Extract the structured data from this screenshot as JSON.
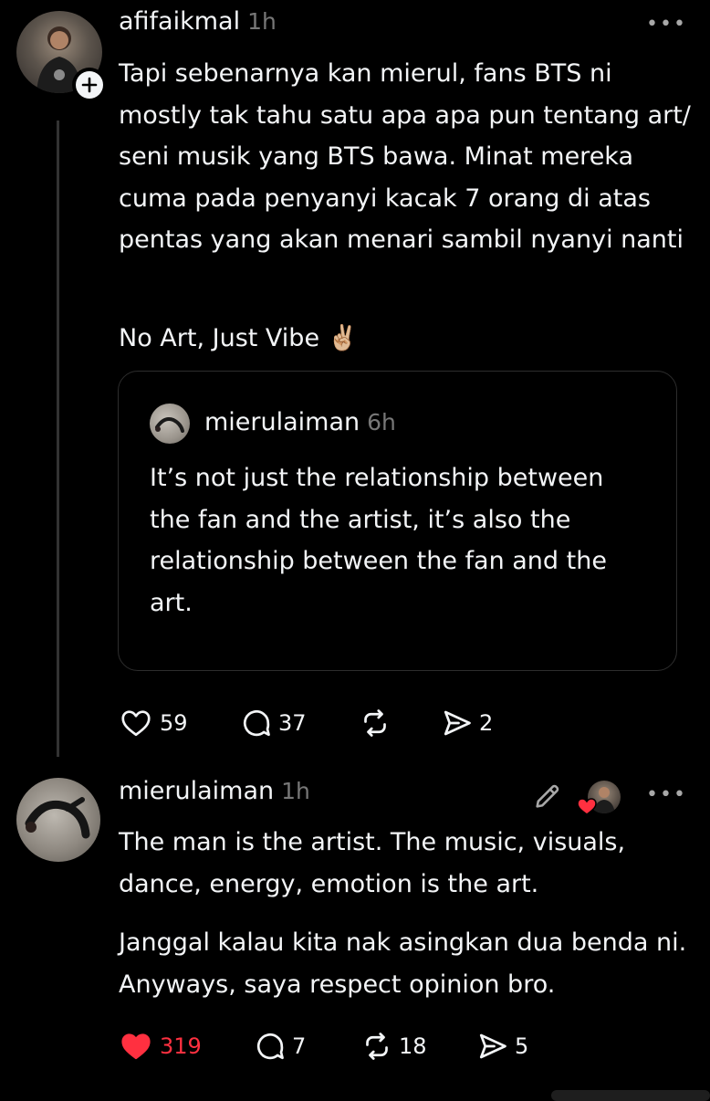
{
  "post1": {
    "username": "afifaikmal",
    "time": "1h",
    "more_label": "•••",
    "text": "Tapi sebenarnya kan mierul, fans BTS ni mostly tak tahu satu apa apa pun tentang art/ seni musik yang BTS bawa. Minat mereka cuma pada penyanyi kacak 7 orang di atas pentas yang akan menari sambil nyanyi nanti",
    "text2": "No Art, Just Vibe ✌🏼",
    "quote": {
      "username": "mierulaiman",
      "time": "6h",
      "text": "It’s not just the relationship between the fan and the artist, it’s also the relationship between the fan and the art."
    },
    "likes": "59",
    "replies": "37",
    "shares": "2"
  },
  "post2": {
    "username": "mierulaiman",
    "time": "1h",
    "more_label": "•••",
    "text1": "The man is the artist. The music, visuals, dance, energy, emotion is the art.",
    "text2": "Janggal kalau kita nak asingkan dua benda ni. Anyways, saya respect opinion bro.",
    "likes": "319",
    "replies": "7",
    "reposts": "18",
    "shares": "5",
    "liked": true,
    "like_color": "#ff3040"
  },
  "icons": {
    "heart": "heart-icon",
    "reply": "reply-icon",
    "repost": "repost-icon",
    "share": "share-icon",
    "follow": "plus-icon",
    "edit": "pencil-icon"
  }
}
